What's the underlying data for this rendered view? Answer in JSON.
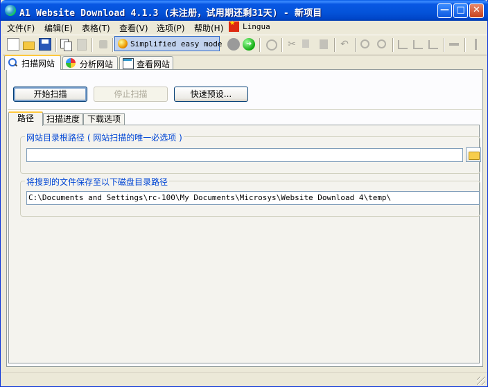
{
  "window": {
    "title": "A1 Website Download 4.1.3 (未注册，试用期还剩31天) - 新项目",
    "minimize_label": "—",
    "maximize_label": "□",
    "close_label": "✕"
  },
  "menu": {
    "items": [
      "文件(F)",
      "编辑(E)",
      "表格(T)",
      "查看(V)",
      "选项(P)",
      "帮助(H)"
    ],
    "lingua_label": "Lingua"
  },
  "toolbar": {
    "easy_mode_label": "Simplified easy mode",
    "icons": [
      "new-file-icon",
      "open-folder-icon",
      "save-icon",
      "copy-project-icon",
      "paste-project-icon",
      "clean-icon",
      "record-icon",
      "go-icon",
      "refresh-icon",
      "cut-icon",
      "copy-icon",
      "paste-icon",
      "undo-icon",
      "find-icon",
      "find-next-icon",
      "tree-collapse-icon",
      "tree-expand-icon",
      "tree-select-icon",
      "move-icon",
      "split-icon"
    ]
  },
  "main_tabs": [
    {
      "label": "扫描网站",
      "icon": "scan-icon",
      "active": true
    },
    {
      "label": "分析网站",
      "icon": "analyze-icon",
      "active": false
    },
    {
      "label": "查看网站",
      "icon": "view-icon",
      "active": false
    }
  ],
  "buttons": {
    "start_scan": "开始扫描",
    "stop_scan": "停止扫描",
    "quick_presets": "快速预设..."
  },
  "sub_tabs": [
    {
      "label": "路径",
      "active": true
    },
    {
      "label": "扫描进度",
      "active": false
    },
    {
      "label": "下载选项",
      "active": false
    }
  ],
  "root_path_group": {
    "title": "网站目录根路径 ( 网站扫描的唯一必选项 )",
    "value": ""
  },
  "save_path_group": {
    "title": "将搜到的文件保存至以下磁盘目录路径",
    "value": "C:\\Documents and Settings\\rc-100\\My Documents\\Microsys\\Website Download 4\\temp\\"
  },
  "colors": {
    "titlebar": "#0453d9",
    "group_title": "#0046d5",
    "active_tab_accent": "#ffc83c",
    "window_bg": "#ece9d8"
  }
}
